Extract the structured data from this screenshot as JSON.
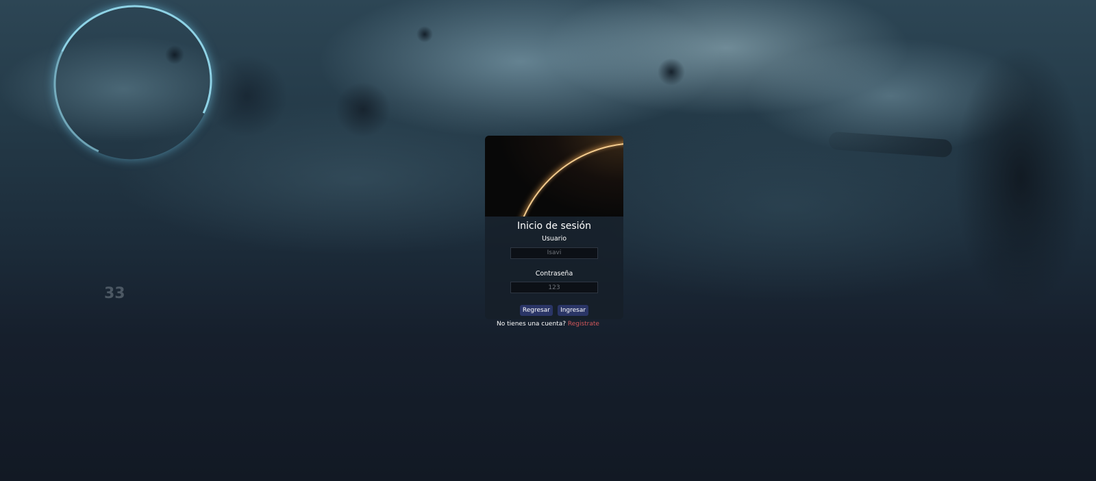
{
  "background": {
    "number_text": "33"
  },
  "login": {
    "title": "Inicio de sesión",
    "username": {
      "label": "Usuario",
      "placeholder": "Isavi"
    },
    "password": {
      "label": "Contraseña",
      "placeholder": "123"
    },
    "buttons": {
      "back_label": "Regresar",
      "submit_label": "Ingresar"
    },
    "register": {
      "prompt": "No tienes una cuenta? ",
      "link_label": "Registrate"
    }
  },
  "colors": {
    "button_bg": "#2a3566",
    "link": "#d2575b",
    "card_bg": "#161e28"
  }
}
